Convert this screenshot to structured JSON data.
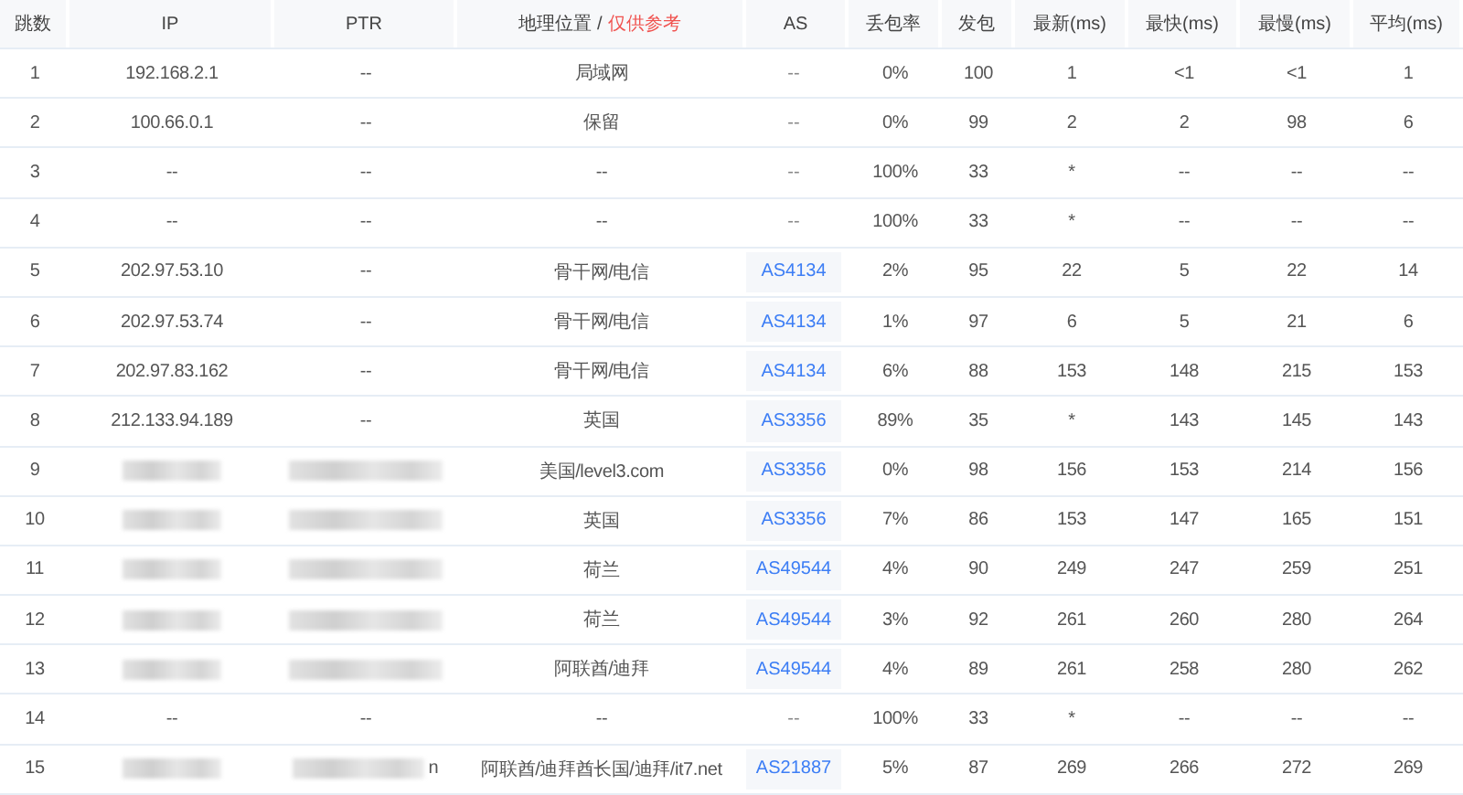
{
  "table": {
    "columns": [
      {
        "label": "跳数"
      },
      {
        "label": "IP"
      },
      {
        "label": "PTR"
      },
      {
        "label": "地理位置 /",
        "note": "仅供参考"
      },
      {
        "label": "AS"
      },
      {
        "label": "丢包率"
      },
      {
        "label": "发包"
      },
      {
        "label": "最新(ms)"
      },
      {
        "label": "最快(ms)"
      },
      {
        "label": "最慢(ms)"
      },
      {
        "label": "平均(ms)"
      }
    ],
    "rows": [
      {
        "hop": "1",
        "ip": {
          "text": "192.168.2.1",
          "redacted": false
        },
        "ptr": {
          "text": "--",
          "redacted": false
        },
        "geo": "局域网",
        "as": {
          "text": "--",
          "link": false
        },
        "loss": "0%",
        "sent": "100",
        "last": "1",
        "best": "<1",
        "worst": "<1",
        "avg": "1"
      },
      {
        "hop": "2",
        "ip": {
          "text": "100.66.0.1",
          "redacted": false
        },
        "ptr": {
          "text": "--",
          "redacted": false
        },
        "geo": "保留",
        "as": {
          "text": "--",
          "link": false
        },
        "loss": "0%",
        "sent": "99",
        "last": "2",
        "best": "2",
        "worst": "98",
        "avg": "6"
      },
      {
        "hop": "3",
        "ip": {
          "text": "--",
          "redacted": false
        },
        "ptr": {
          "text": "--",
          "redacted": false
        },
        "geo": "--",
        "as": {
          "text": "--",
          "link": false
        },
        "loss": "100%",
        "sent": "33",
        "last": "*",
        "best": "--",
        "worst": "--",
        "avg": "--"
      },
      {
        "hop": "4",
        "ip": {
          "text": "--",
          "redacted": false
        },
        "ptr": {
          "text": "--",
          "redacted": false
        },
        "geo": "--",
        "as": {
          "text": "--",
          "link": false
        },
        "loss": "100%",
        "sent": "33",
        "last": "*",
        "best": "--",
        "worst": "--",
        "avg": "--"
      },
      {
        "hop": "5",
        "ip": {
          "text": "202.97.53.10",
          "redacted": false
        },
        "ptr": {
          "text": "--",
          "redacted": false
        },
        "geo": "骨干网/电信",
        "as": {
          "text": "AS4134",
          "link": true
        },
        "loss": "2%",
        "sent": "95",
        "last": "22",
        "best": "5",
        "worst": "22",
        "avg": "14"
      },
      {
        "hop": "6",
        "ip": {
          "text": "202.97.53.74",
          "redacted": false
        },
        "ptr": {
          "text": "--",
          "redacted": false
        },
        "geo": "骨干网/电信",
        "as": {
          "text": "AS4134",
          "link": true
        },
        "loss": "1%",
        "sent": "97",
        "last": "6",
        "best": "5",
        "worst": "21",
        "avg": "6"
      },
      {
        "hop": "7",
        "ip": {
          "text": "202.97.83.162",
          "redacted": false
        },
        "ptr": {
          "text": "--",
          "redacted": false
        },
        "geo": "骨干网/电信",
        "as": {
          "text": "AS4134",
          "link": true
        },
        "loss": "6%",
        "sent": "88",
        "last": "153",
        "best": "148",
        "worst": "215",
        "avg": "153"
      },
      {
        "hop": "8",
        "ip": {
          "text": "212.133.94.189",
          "redacted": false
        },
        "ptr": {
          "text": "--",
          "redacted": false
        },
        "geo": "英国",
        "as": {
          "text": "AS3356",
          "link": true
        },
        "loss": "89%",
        "sent": "35",
        "last": "*",
        "best": "143",
        "worst": "145",
        "avg": "143"
      },
      {
        "hop": "9",
        "ip": {
          "redacted": true
        },
        "ptr": {
          "redacted": true
        },
        "geo": "美国/level3.com",
        "as": {
          "text": "AS3356",
          "link": true
        },
        "loss": "0%",
        "sent": "98",
        "last": "156",
        "best": "153",
        "worst": "214",
        "avg": "156"
      },
      {
        "hop": "10",
        "ip": {
          "redacted": true
        },
        "ptr": {
          "redacted": true
        },
        "geo": "英国",
        "as": {
          "text": "AS3356",
          "link": true
        },
        "loss": "7%",
        "sent": "86",
        "last": "153",
        "best": "147",
        "worst": "165",
        "avg": "151"
      },
      {
        "hop": "11",
        "ip": {
          "redacted": true
        },
        "ptr": {
          "redacted": true
        },
        "geo": "荷兰",
        "as": {
          "text": "AS49544",
          "link": true
        },
        "loss": "4%",
        "sent": "90",
        "last": "249",
        "best": "247",
        "worst": "259",
        "avg": "251"
      },
      {
        "hop": "12",
        "ip": {
          "redacted": true
        },
        "ptr": {
          "redacted": true
        },
        "geo": "荷兰",
        "as": {
          "text": "AS49544",
          "link": true
        },
        "loss": "3%",
        "sent": "92",
        "last": "261",
        "best": "260",
        "worst": "280",
        "avg": "264"
      },
      {
        "hop": "13",
        "ip": {
          "redacted": true
        },
        "ptr": {
          "redacted": true
        },
        "geo": "阿联酋/迪拜",
        "as": {
          "text": "AS49544",
          "link": true
        },
        "loss": "4%",
        "sent": "89",
        "last": "261",
        "best": "258",
        "worst": "280",
        "avg": "262"
      },
      {
        "hop": "14",
        "ip": {
          "text": "--",
          "redacted": false
        },
        "ptr": {
          "text": "--",
          "redacted": false
        },
        "geo": "--",
        "as": {
          "text": "--",
          "link": false
        },
        "loss": "100%",
        "sent": "33",
        "last": "*",
        "best": "--",
        "worst": "--",
        "avg": "--"
      },
      {
        "hop": "15",
        "ip": {
          "redacted": true
        },
        "ptr": {
          "text": "n",
          "redacted": true
        },
        "geo": "阿联酋/迪拜酋长国/迪拜/it7.net",
        "as": {
          "text": "AS21887",
          "link": true
        },
        "loss": "5%",
        "sent": "87",
        "last": "269",
        "best": "266",
        "worst": "272",
        "avg": "269"
      }
    ]
  }
}
